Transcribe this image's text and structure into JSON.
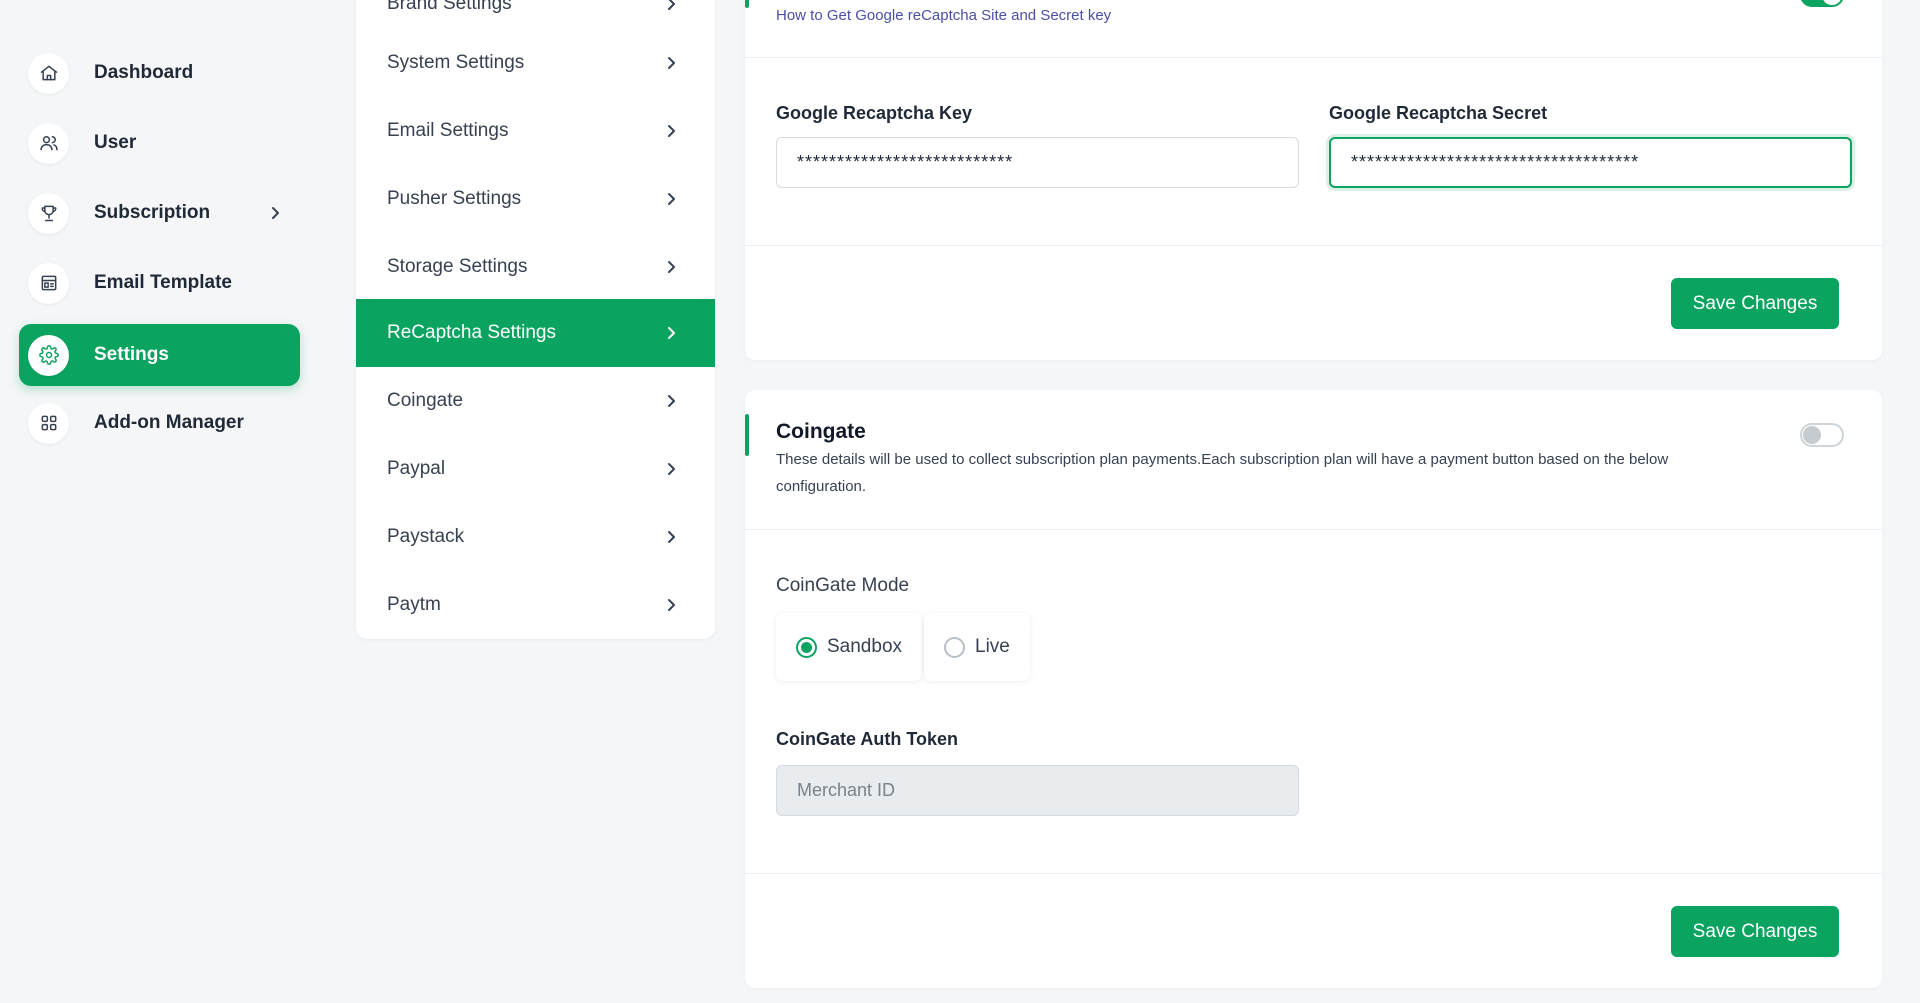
{
  "sidebar": {
    "items": [
      {
        "label": "Dashboard",
        "icon": "home-icon"
      },
      {
        "label": "User",
        "icon": "users-icon"
      },
      {
        "label": "Subscription",
        "icon": "trophy-icon"
      },
      {
        "label": "Email Template",
        "icon": "template-icon"
      },
      {
        "label": "Settings",
        "icon": "gear-icon",
        "active": true
      },
      {
        "label": "Add-on Manager",
        "icon": "grid-icon"
      }
    ]
  },
  "settings_menu": {
    "items": [
      {
        "label": "Brand Settings"
      },
      {
        "label": "System Settings"
      },
      {
        "label": "Email Settings"
      },
      {
        "label": "Pusher Settings"
      },
      {
        "label": "Storage Settings"
      },
      {
        "label": "ReCaptcha Settings",
        "active": true
      },
      {
        "label": "Coingate"
      },
      {
        "label": "Paypal"
      },
      {
        "label": "Paystack"
      },
      {
        "label": "Paytm"
      }
    ]
  },
  "recaptcha": {
    "help_link": "How to Get Google reCaptcha Site and Secret key",
    "enabled": true,
    "key_label": "Google Recaptcha Key",
    "key_value": "***************************",
    "secret_label": "Google Recaptcha Secret",
    "secret_value": "************************************",
    "save_label": "Save Changes"
  },
  "coingate": {
    "title": "Coingate",
    "description": "These details will be used to collect subscription plan payments.Each subscription plan will have a payment button based on the below configuration.",
    "enabled": false,
    "mode_label": "CoinGate Mode",
    "modes": [
      {
        "label": "Sandbox",
        "checked": true
      },
      {
        "label": "Live",
        "checked": false
      }
    ],
    "token_label": "CoinGate Auth Token",
    "token_placeholder": "Merchant ID",
    "save_label": "Save Changes"
  },
  "colors": {
    "accent": "#0ba360",
    "background": "#f4f6f7",
    "link": "#4b4fa6"
  }
}
